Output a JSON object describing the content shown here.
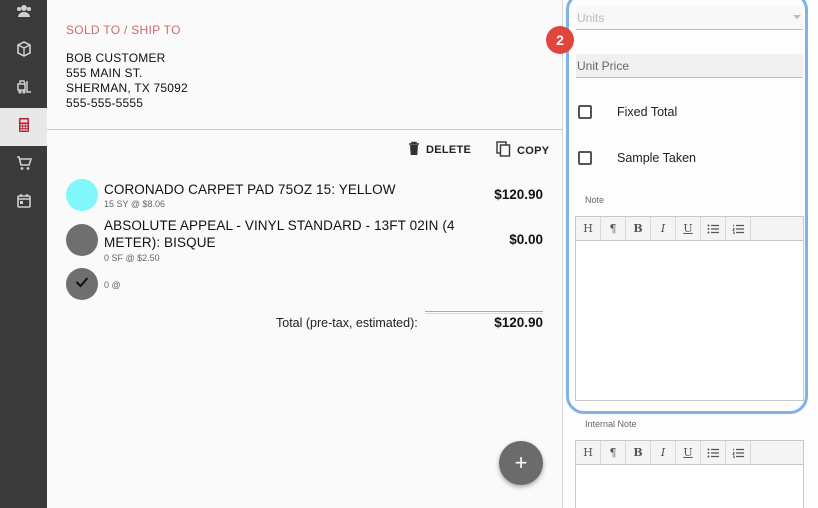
{
  "sidebar": {
    "items": [
      {
        "icon": "users-icon"
      },
      {
        "icon": "box-icon"
      },
      {
        "icon": "forklift-icon"
      },
      {
        "icon": "calculator-icon",
        "active": true
      },
      {
        "icon": "cart-icon"
      },
      {
        "icon": "calendar-icon"
      }
    ]
  },
  "customer": {
    "section_label": "SOLD TO / SHIP TO",
    "name": "BOB CUSTOMER",
    "street": "555 MAIN ST.",
    "city_state_zip": "SHERMAN, TX 75092",
    "phone": "555-555-5555"
  },
  "actions": {
    "delete_label": "DELETE",
    "copy_label": "COPY"
  },
  "line_items": [
    {
      "name": "CORONADO CARPET PAD 75OZ 15: YELLOW",
      "detail": "15 SY @ $8.06",
      "price": "$120.90",
      "color": "#80f7fb"
    },
    {
      "name_line1": "ABSOLUTE APPEAL - VINYL STANDARD - 13FT 02IN (4",
      "name_line2": "METER): BISQUE",
      "detail": "0 SF @ $2.50",
      "price": "$0.00",
      "color": "#6f6f6f"
    },
    {
      "detail": "0 @",
      "checked": true,
      "color": "#6f6f6f"
    }
  ],
  "totals": {
    "label": "Total (pre-tax, estimated):",
    "value": "$120.90"
  },
  "fab_label": "+",
  "panel": {
    "step_badge": "2",
    "units_placeholder": "Units",
    "unit_price_placeholder": "Unit Price",
    "fixed_total_label": "Fixed Total",
    "sample_taken_label": "Sample Taken",
    "note_label": "Note",
    "internal_note_label": "Internal Note",
    "toolbar": [
      "H",
      "¶",
      "B",
      "I",
      "U"
    ]
  },
  "colors": {
    "accent_red": "#d06b6b",
    "highlight_blue": "#7fb2e5",
    "badge_red": "#e2453c",
    "sidebar_active": "#b0233a"
  }
}
